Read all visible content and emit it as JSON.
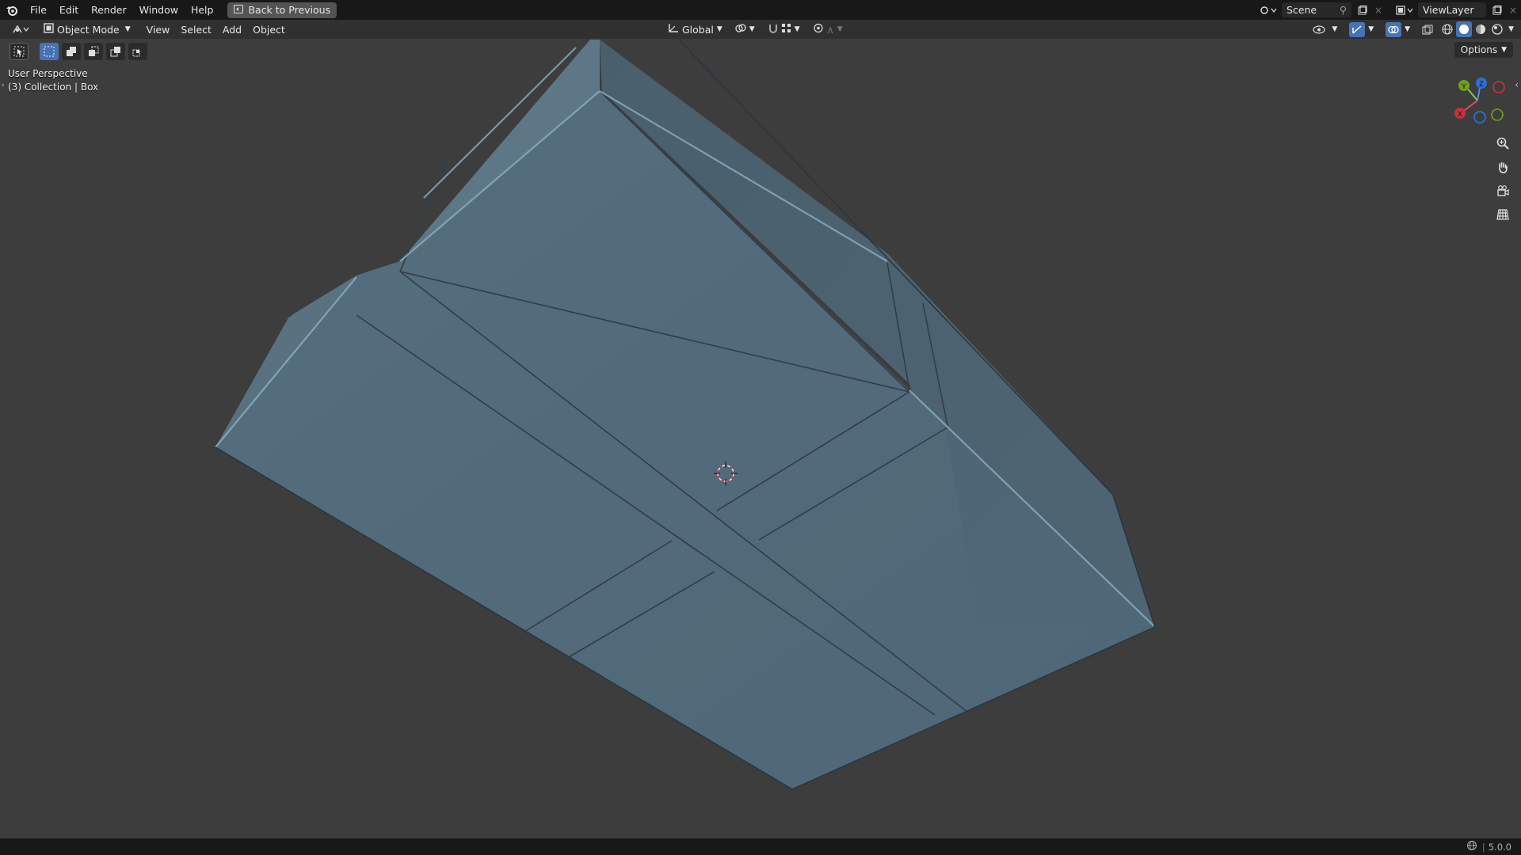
{
  "menu": {
    "file": "File",
    "edit": "Edit",
    "render": "Render",
    "window": "Window",
    "help": "Help",
    "back_to_previous": "Back to Previous"
  },
  "topbar_right": {
    "scene": "Scene",
    "view_layer": "ViewLayer"
  },
  "header": {
    "mode": "Object Mode",
    "view": "View",
    "select": "Select",
    "add": "Add",
    "object": "Object",
    "transform_orientation": "Global"
  },
  "toolrow": {
    "options": "Options"
  },
  "viewport": {
    "perspective_label": "User Perspective",
    "collection_label": "(3) Collection | Box"
  },
  "gizmo": {
    "x": "X",
    "y": "Y",
    "z": "Z"
  },
  "status": {
    "version": "5.0.0"
  },
  "colors": {
    "topbar": "#181818",
    "header": "#303030",
    "viewport_bg": "#3d3d3d",
    "mesh_face": "#546a77",
    "accent_blue": "#4772b3",
    "axis_x": "#c8313e",
    "axis_y": "#6ea01f",
    "axis_z": "#2e6fcf"
  },
  "icons": [
    "blender-logo-icon",
    "back-icon",
    "editor-type-icon",
    "object-mode-icon",
    "orientation-icon",
    "snap-icon",
    "proportional-icon",
    "visibility-icon",
    "gizmo-icon",
    "overlay-icon",
    "xray-icon",
    "wireframe-icon",
    "solid-icon",
    "material-icon",
    "rendered-icon",
    "zoom-icon",
    "pan-hand-icon",
    "camera-icon",
    "grid-icon",
    "scene-icon",
    "view-layer-icon"
  ]
}
